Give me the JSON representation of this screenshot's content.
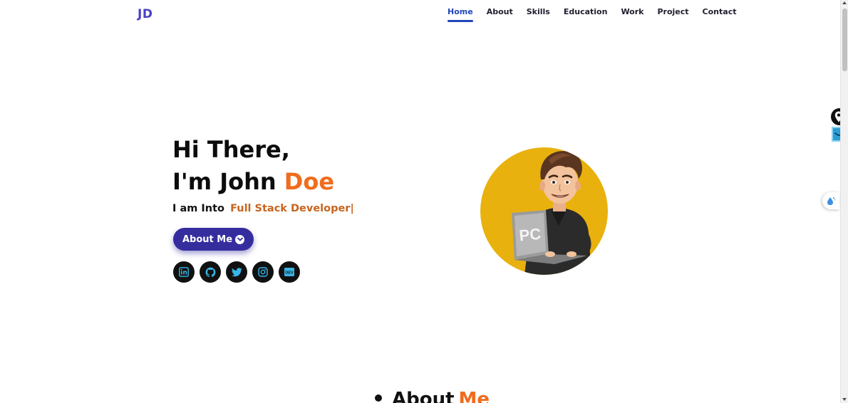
{
  "header": {
    "logo": "JD",
    "nav": [
      "Home",
      "About",
      "Skills",
      "Education",
      "Work",
      "Project",
      "Contact"
    ],
    "active": "Home"
  },
  "hero": {
    "greeting": "Hi There,",
    "name_prefix": "I'm John ",
    "name_accent": "Doe",
    "into_label": "I am Into",
    "role": "Full Stack Developer|",
    "button_label": "About Me",
    "socials": [
      "linkedin-icon",
      "github-icon",
      "twitter-icon",
      "instagram-icon",
      "dev-icon"
    ],
    "avatar_text": "PC"
  },
  "about_section": {
    "title_prefix": "About",
    "title_accent": "Me"
  },
  "colors": {
    "brand": "#4a3fc4",
    "nav_active": "#2246b8",
    "accent_orange": "#f06c1d",
    "button_bg": "#352d9e",
    "avatar_bg": "#e8b10d",
    "social_bg": "#111111",
    "social_icon": "#38b6e8"
  }
}
